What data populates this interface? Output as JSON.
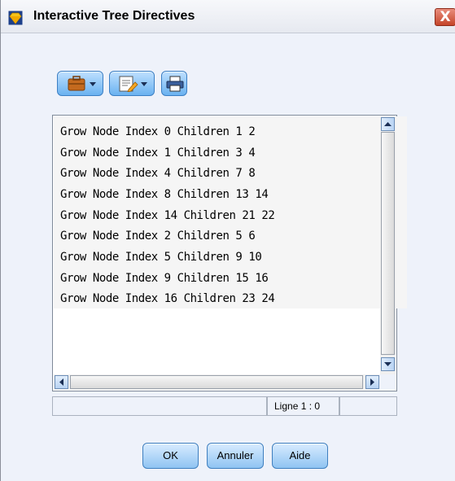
{
  "window": {
    "title": "Interactive Tree Directives",
    "close_label": "X"
  },
  "toolbar": {
    "buttons": [
      {
        "icon": "briefcase-dropdown-icon"
      },
      {
        "icon": "edit-document-dropdown-icon"
      },
      {
        "icon": "print-icon"
      }
    ]
  },
  "editor": {
    "lines": [
      "Grow Node Index 0 Children 1 2",
      "Grow Node Index 1 Children 3 4",
      "Grow Node Index 4 Children 7 8",
      "Grow Node Index 8 Children 13 14",
      "Grow Node Index 14 Children 21 22",
      "Grow Node Index 2 Children 5 6",
      "Grow Node Index 5 Children 9 10",
      "Grow Node Index 9 Children 15 16",
      "Grow Node Index 16 Children 23 24"
    ]
  },
  "status": {
    "position": "Ligne 1 : 0"
  },
  "buttons": {
    "ok": "OK",
    "cancel": "Annuler",
    "help": "Aide"
  }
}
